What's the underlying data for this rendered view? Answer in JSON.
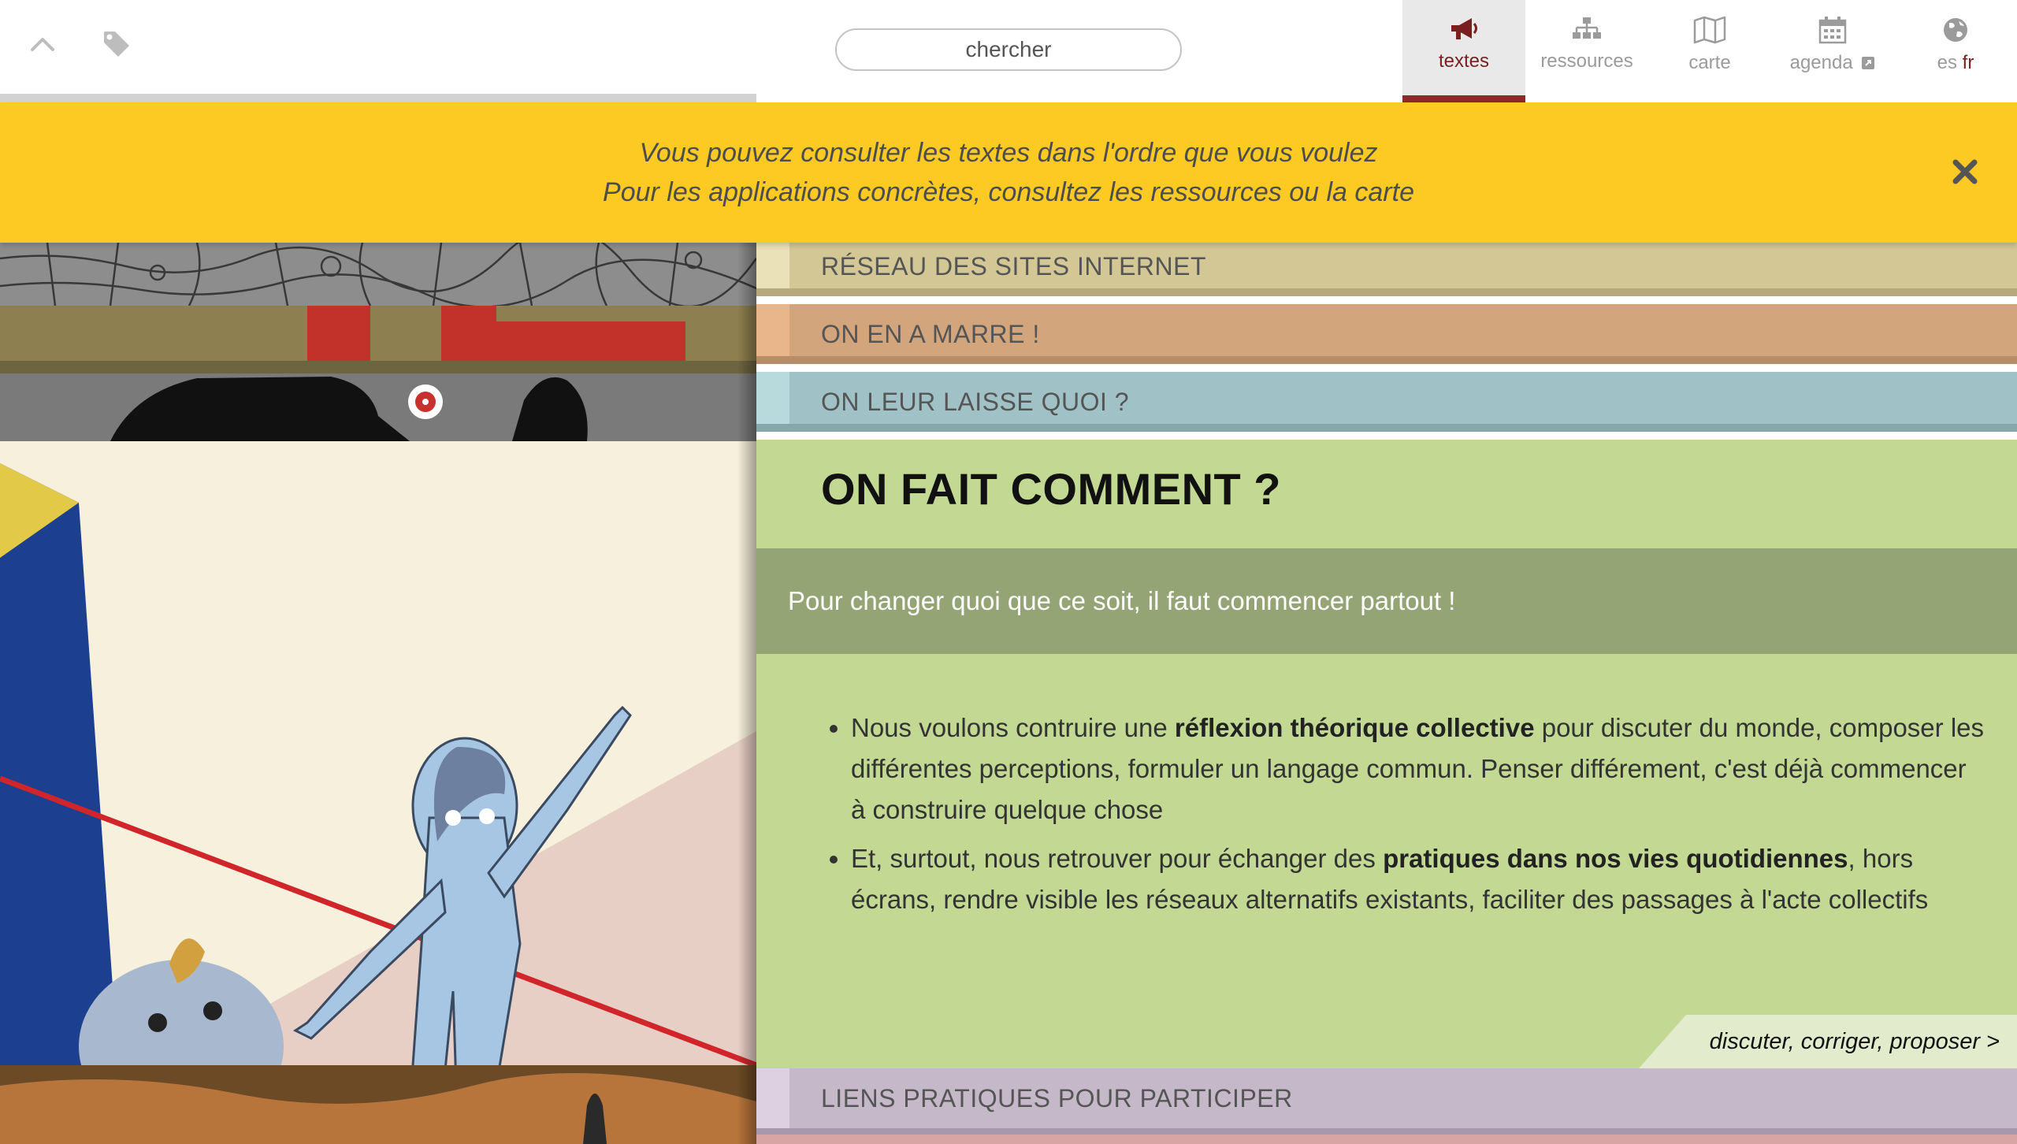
{
  "search": {
    "placeholder": "chercher"
  },
  "nav": {
    "items": [
      {
        "label": "textes",
        "icon": "megaphone-icon",
        "active": true
      },
      {
        "label": "ressources",
        "icon": "sitemap-icon"
      },
      {
        "label": "carte",
        "icon": "map-icon"
      },
      {
        "label": "agenda",
        "icon": "calendar-icon",
        "extra_icon": "external-link-icon"
      }
    ],
    "lang": {
      "icon": "globe-icon",
      "other": "es",
      "current": "fr"
    }
  },
  "notice": {
    "line1": "Vous pouvez consulter les textes dans l'ordre que vous voulez",
    "line2": "Pour les applications concrètes, consultez les ressources ou la carte"
  },
  "sections": {
    "s1": "RÉSEAU DES SITES INTERNET",
    "s2": "ON EN A MARRE !",
    "s3": "ON LEUR LAISSE QUOI ?",
    "s4": "LIENS PRATIQUES POUR PARTICIPER"
  },
  "main": {
    "title": "ON FAIT COMMENT ?",
    "subtitle": "Pour changer quoi que ce soit, il faut commencer partout !",
    "bullet1": {
      "pre": "Nous voulons contruire une ",
      "bold": "réflexion théorique collective",
      "post": " pour discuter du monde, composer les différentes perceptions, formuler un langage commun. Penser différement, c'est déjà commencer à construire quelque chose"
    },
    "bullet2": {
      "pre": "Et, surtout, nous retrouver pour échanger des ",
      "bold": "pratiques dans nos vies quotidiennes",
      "post": ", hors écrans, rendre visible les réseaux alternatifs existants, faciliter des passages à l'acte collectifs"
    },
    "discuss_link": "discuter, corriger, proposer >"
  },
  "colors": {
    "notice_bg": "#fcca23",
    "active_nav": "#7a1f1f",
    "main_bg": "#c2d893",
    "subtitle_bg": "#94a474"
  }
}
